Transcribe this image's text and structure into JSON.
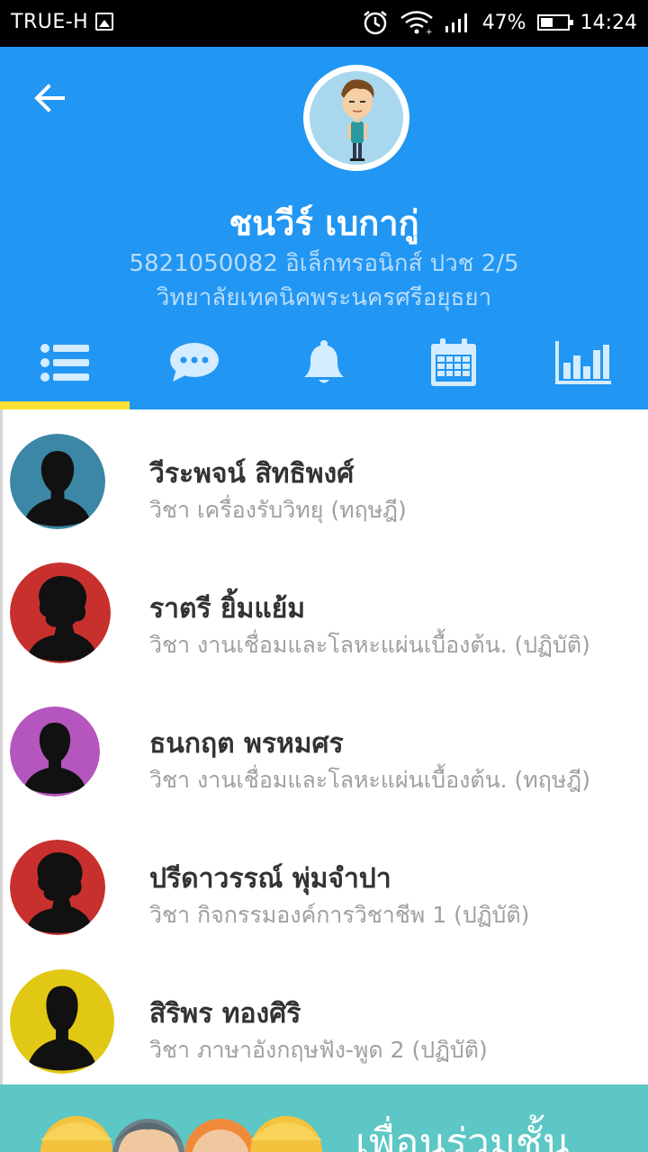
{
  "status_bar": {
    "carrier": "TRUE-H",
    "battery": "47%",
    "battery_level": 0.47,
    "time": "14:24",
    "icons": [
      "image-icon",
      "alarm-icon",
      "wifi-icon",
      "signal-icon",
      "battery-icon"
    ]
  },
  "profile": {
    "name": "ชนวีร์ เบกากู่",
    "line1": "5821050082 อิเล็กทรอนิกส์ ปวช 2/5",
    "line2": "วิทยาลัยเทคนิคพระนครศรีอยุธยา",
    "avatar": "cartoon-boy-avatar"
  },
  "tabs": [
    {
      "icon": "list-icon",
      "selected": true
    },
    {
      "icon": "chat-icon",
      "selected": false
    },
    {
      "icon": "bell-icon",
      "selected": false
    },
    {
      "icon": "calendar-icon",
      "selected": false
    },
    {
      "icon": "chart-icon",
      "selected": false
    }
  ],
  "teachers": [
    {
      "name": "วีระพจน์ สิทธิพงศ์",
      "subject": "วิชา เครื่องรับวิทยุ (ทฤษฎี)",
      "color": "#3c87a6",
      "avatar": "male-silhouette"
    },
    {
      "name": "ราตรี ยิ้มแย้ม",
      "subject": "วิชา งานเชื่อมและโลหะแผ่นเบื้องต้น. (ปฏิบัติ)",
      "color": "#c8302e",
      "avatar": "female-silhouette"
    },
    {
      "name": "ธนกฤต พรหมศร",
      "subject": "วิชา งานเชื่อมและโลหะแผ่นเบื้องต้น. (ทฤษฎี)",
      "color": "#b555be",
      "avatar": "male-silhouette"
    },
    {
      "name": "ปรีดาวรรณ์ พุ่มจำปา",
      "subject": "วิชา กิจกรรมองค์การวิชาชีพ 1 (ปฏิบัติ)",
      "color": "#c8302e",
      "avatar": "female-silhouette"
    },
    {
      "name": "สิริพร ทองศิริ",
      "subject": "วิชา ภาษาอังกฤษฟัง-พูด 2 (ปฏิบัติ)",
      "color": "#e1c814",
      "avatar": "male-silhouette"
    }
  ],
  "banner": {
    "text": "เพื่อนร่วมชั้น"
  },
  "colors": {
    "primary": "#2196f3",
    "tab_indicator": "#fde233",
    "banner": "#5cc7c4"
  }
}
